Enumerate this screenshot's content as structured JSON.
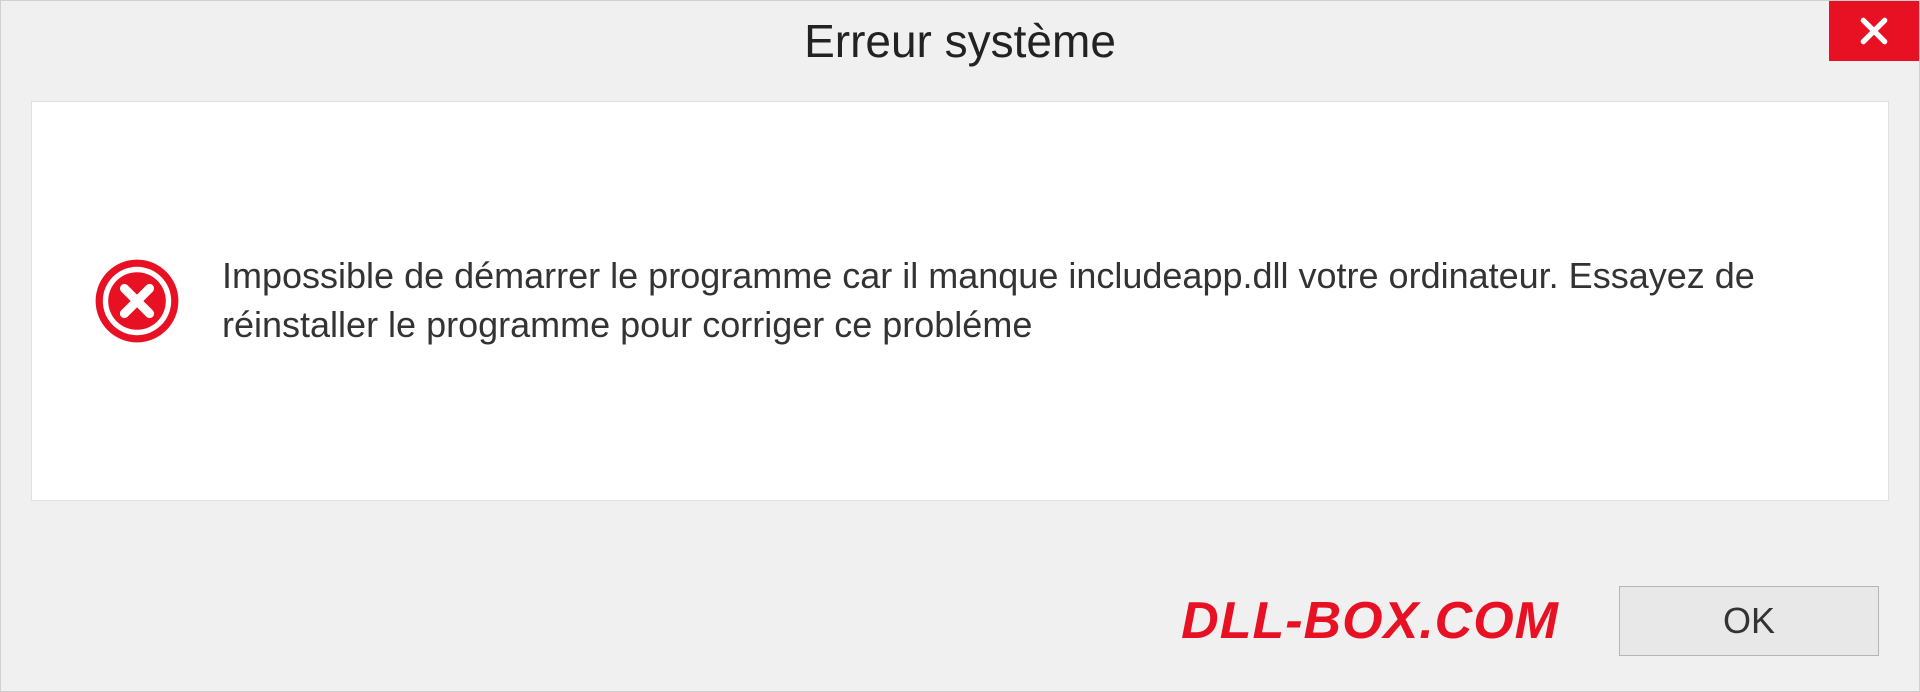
{
  "dialog": {
    "title": "Erreur système",
    "message": "Impossible de démarrer le programme car il manque includeapp.dll votre ordinateur. Essayez de réinstaller le programme pour corriger ce probléme",
    "ok_label": "OK",
    "watermark": "DLL-BOX.COM"
  },
  "colors": {
    "accent_red": "#e81123"
  }
}
